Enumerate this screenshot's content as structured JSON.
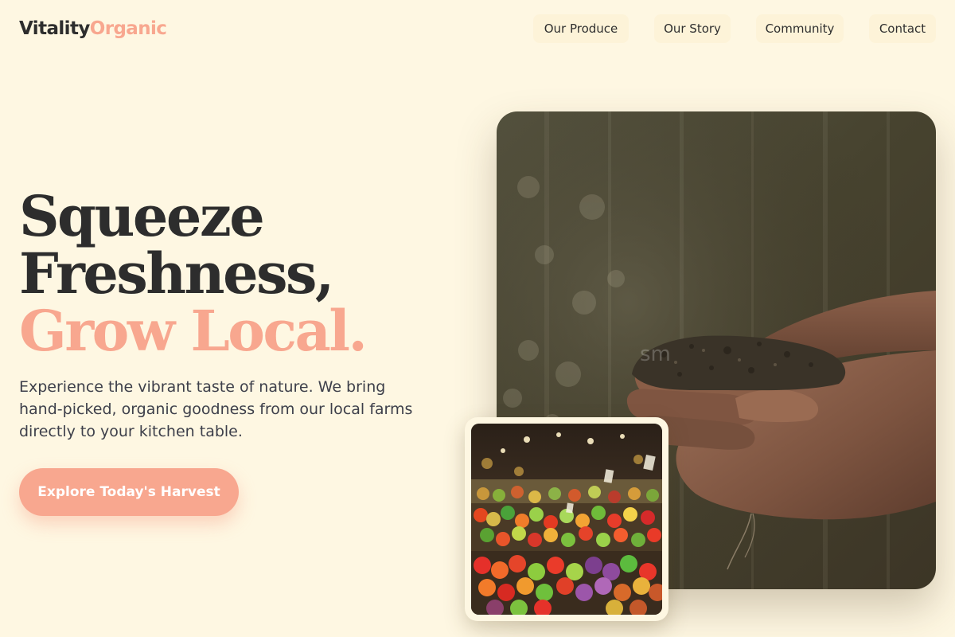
{
  "header": {
    "logo_primary": "Vitality",
    "logo_accent": "Organic",
    "nav": [
      {
        "label": "Our Produce"
      },
      {
        "label": "Our Story"
      },
      {
        "label": "Community"
      },
      {
        "label": "Contact"
      }
    ]
  },
  "hero": {
    "headline_line1": "Squeeze",
    "headline_line2": "Freshness,",
    "headline_accent": "Grow Local.",
    "description": "Experience the vibrant taste of nature. We bring hand-picked, organic goodness from our local farms directly to your kitchen table.",
    "cta_label": "Explore Today's Harvest"
  },
  "images": {
    "main_watermark": "sm"
  },
  "colors": {
    "background": "#fef7e2",
    "accent": "#f8a78f",
    "text_dark": "#2d2d2d",
    "text_body": "#3d3f4a"
  }
}
